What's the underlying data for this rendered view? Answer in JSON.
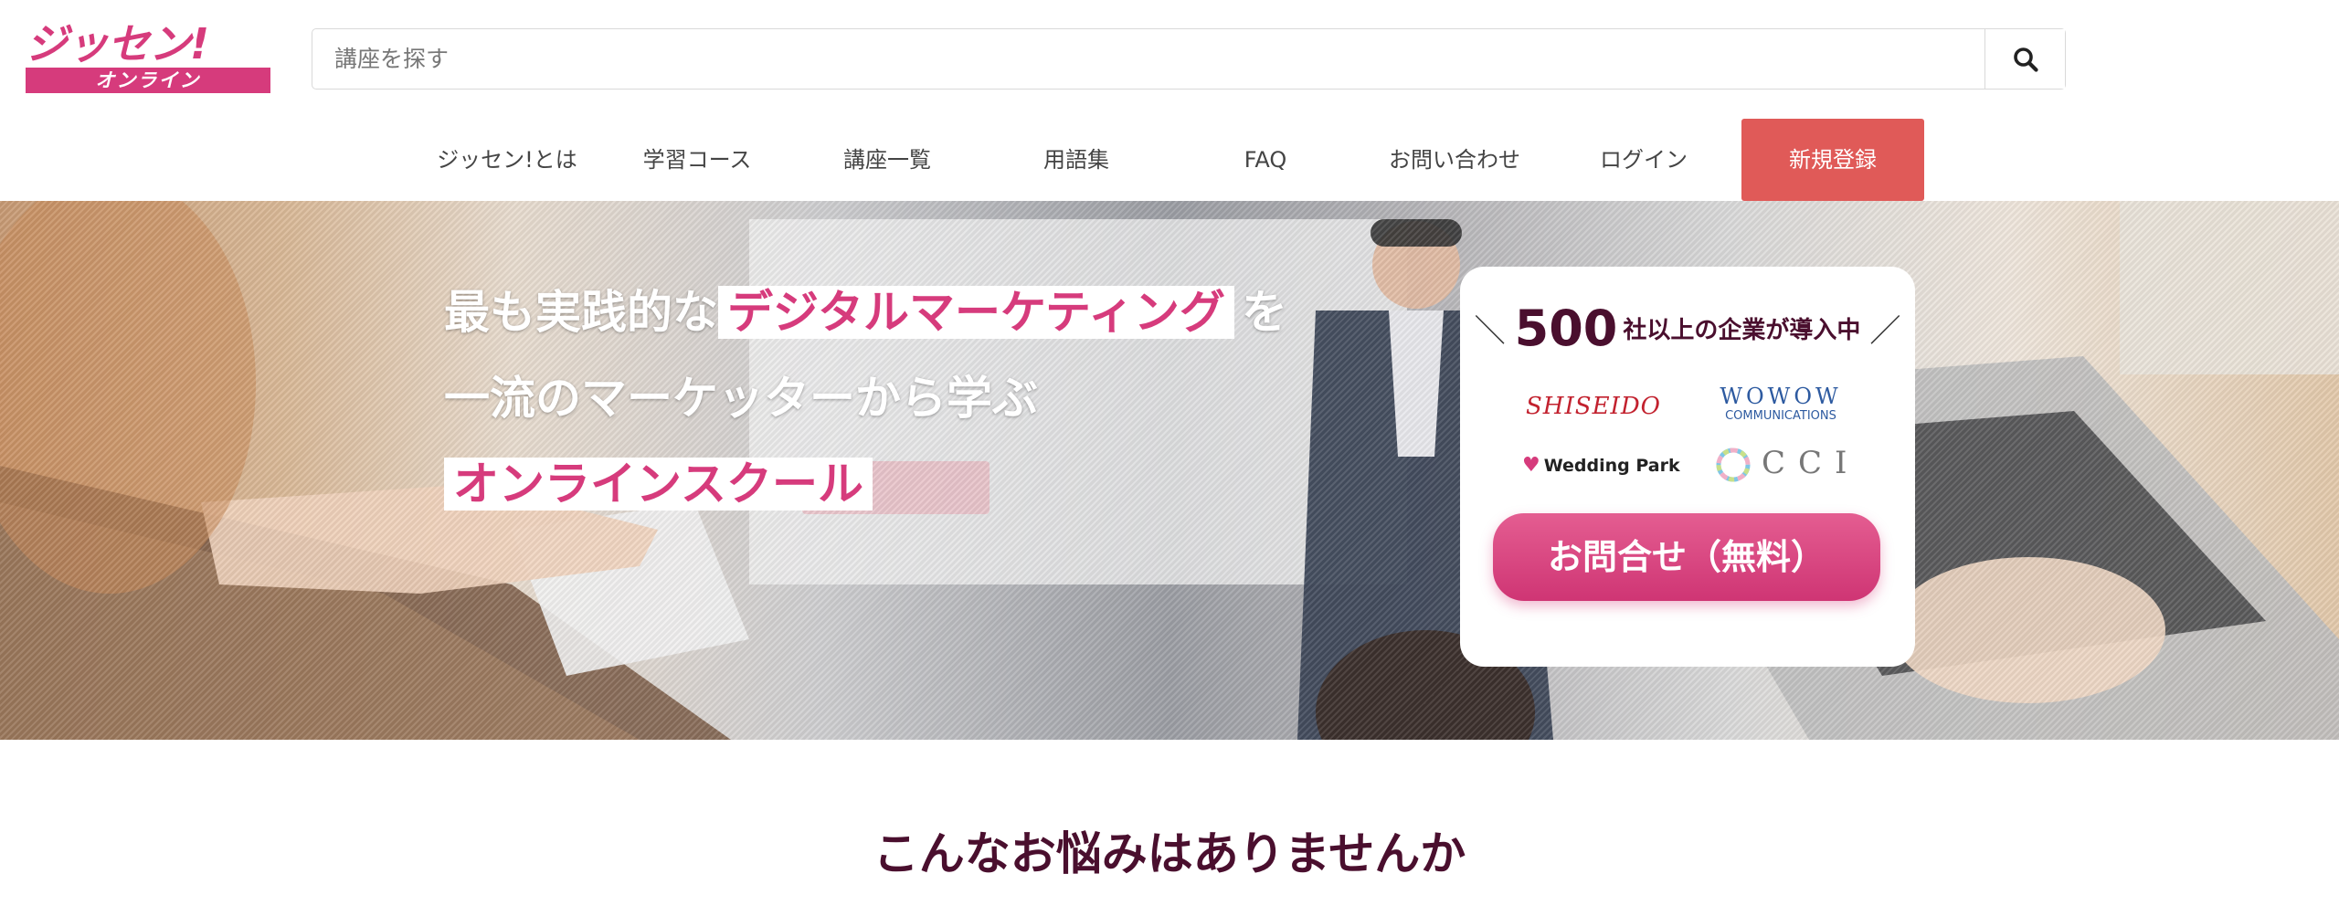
{
  "brand": {
    "logo_main": "ジッセン!",
    "logo_sub": "オンライン",
    "color": "#d63b7c"
  },
  "search": {
    "placeholder": "講座を探す",
    "value": "",
    "icon": "search-icon"
  },
  "nav": {
    "items": [
      {
        "label": "ジッセン!とは"
      },
      {
        "label": "学習コース"
      },
      {
        "label": "講座一覧"
      },
      {
        "label": "用語集"
      },
      {
        "label": "FAQ"
      },
      {
        "label": "お問い合わせ"
      },
      {
        "label": "ログイン"
      }
    ],
    "register": "新規登録",
    "register_color": "#e05a58"
  },
  "hero": {
    "line1_pre": "最も実践的な",
    "line1_highlight": "デジタルマーケティング",
    "line1_post": "を",
    "line2": "一流のマーケッターから学ぶ",
    "line3_highlight": "オンラインスクール",
    "card": {
      "slash_left": "＼",
      "count": "500",
      "count_text": "社以上の企業が導入中",
      "slash_right": "／",
      "logos": {
        "shiseido": "SHISEIDO",
        "wowow_main": "WOWOW",
        "wowow_sub": "COMMUNICATIONS",
        "wedding": "Wedding Park",
        "cci": "CCI"
      },
      "cta": "お問合せ（無料）"
    }
  },
  "section": {
    "title": "こんなお悩みはありませんか"
  }
}
